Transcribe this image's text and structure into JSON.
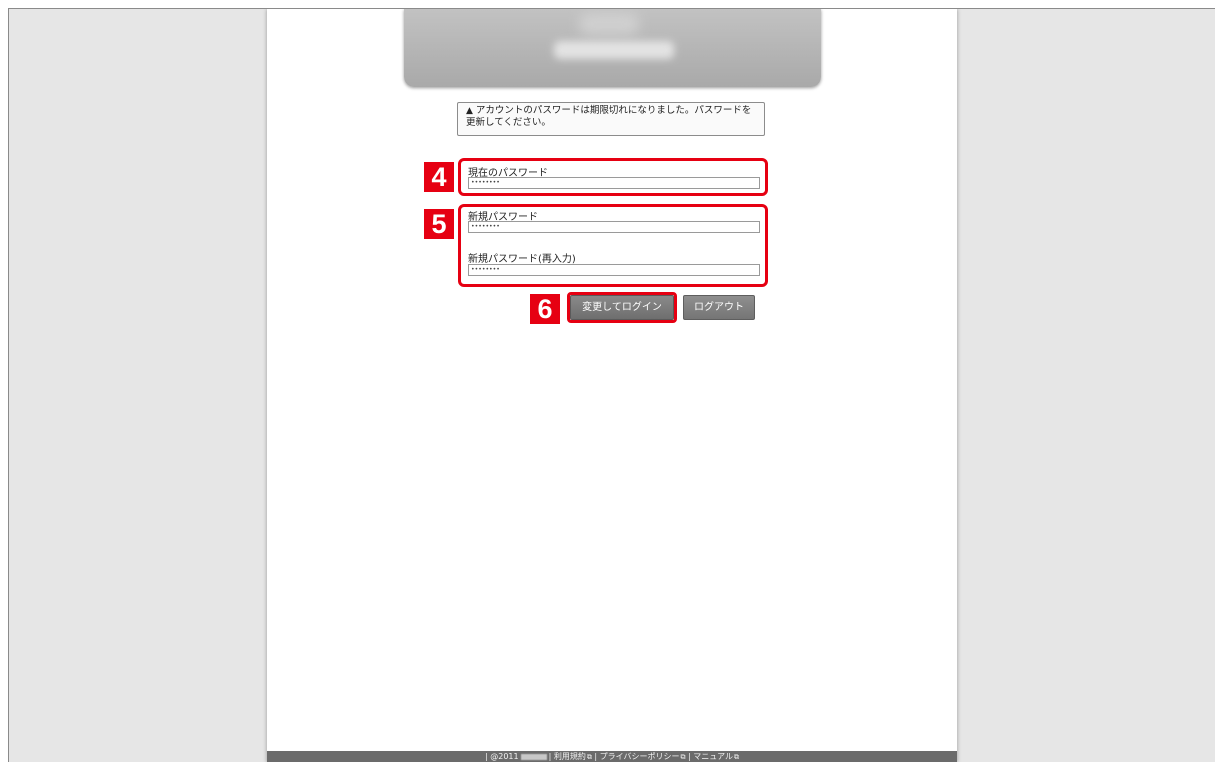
{
  "notice": {
    "icon": "warning-triangle-icon",
    "text": "アカウントのパスワードは期限切れになりました。パスワードを更新してください。"
  },
  "fields": {
    "current_password": {
      "label": "現在のパスワード",
      "value": "••••••••"
    },
    "new_password": {
      "label": "新規パスワード",
      "value": "••••••••"
    },
    "new_password_confirm": {
      "label": "新規パスワード(再入力)",
      "value": "••••••••"
    }
  },
  "steps": {
    "current": "4",
    "new": "5",
    "submit": "6"
  },
  "buttons": {
    "change_login": "変更してログイン",
    "logout": "ログアウト"
  },
  "footer": {
    "copyright": "@2011",
    "links": [
      "利用規約",
      "プライバシーポリシー",
      "マニュアル"
    ]
  },
  "colors": {
    "highlight": "#e60012",
    "button": "#767676",
    "footer": "#6b6b6b"
  }
}
